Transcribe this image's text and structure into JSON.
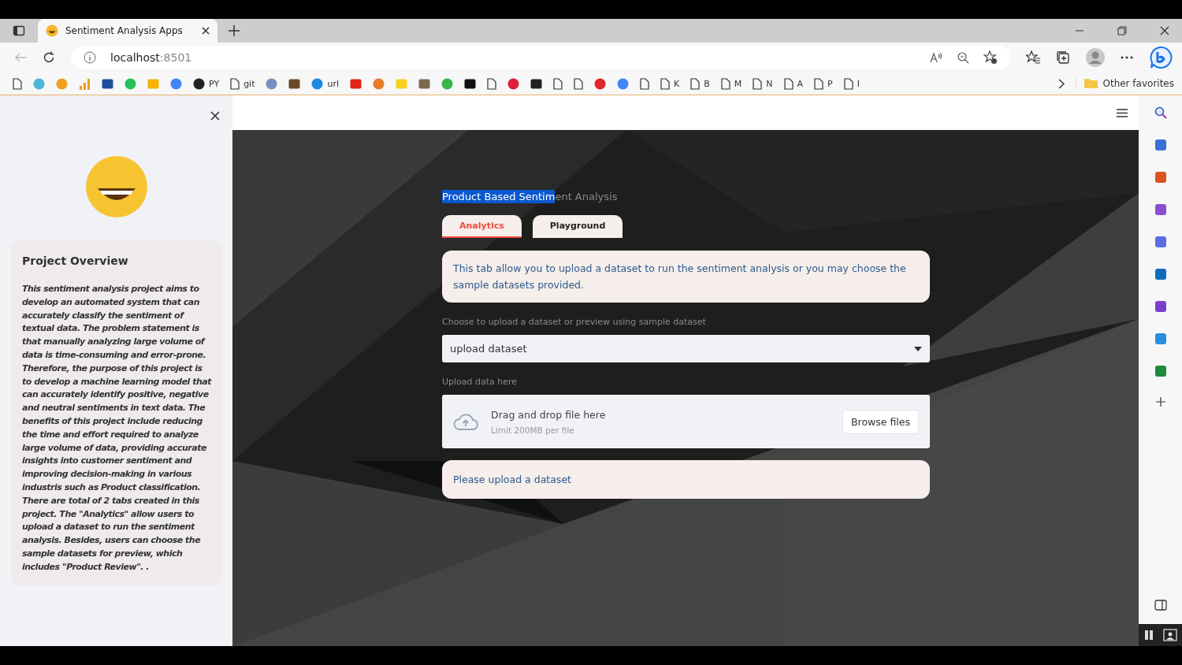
{
  "browser": {
    "tab_title": "Sentiment Analysis Apps",
    "address_host": "localhost",
    "address_port": ":8501",
    "bookmarks": [
      {
        "kind": "page"
      },
      {
        "kind": "dot",
        "color": "#4fb6d6"
      },
      {
        "kind": "dot",
        "color": "#f0a020"
      },
      {
        "kind": "bars",
        "color": "#f29b1d"
      },
      {
        "kind": "square",
        "color": "#1f4e9a"
      },
      {
        "kind": "dot",
        "color": "#25c15a"
      },
      {
        "kind": "square",
        "color": "#f4b400"
      },
      {
        "kind": "dot",
        "color": "#4285f4"
      },
      {
        "kind": "dot",
        "color": "#222222",
        "label": "PY"
      },
      {
        "kind": "page",
        "label": "git"
      },
      {
        "kind": "dot",
        "color": "#7a8fc0"
      },
      {
        "kind": "square",
        "color": "#6b4a2a"
      },
      {
        "kind": "dot",
        "color": "#1e88e5",
        "label": "url"
      },
      {
        "kind": "square",
        "color": "#e62117"
      },
      {
        "kind": "dot",
        "color": "#e87a2a"
      },
      {
        "kind": "square",
        "color": "#f7d11e"
      },
      {
        "kind": "square",
        "color": "#7a6a50"
      },
      {
        "kind": "dot",
        "color": "#3cb54a"
      },
      {
        "kind": "square",
        "color": "#111111"
      },
      {
        "kind": "page"
      },
      {
        "kind": "dot",
        "color": "#e0203a"
      },
      {
        "kind": "square",
        "color": "#202020"
      },
      {
        "kind": "page"
      },
      {
        "kind": "page"
      },
      {
        "kind": "dot",
        "color": "#e3262e"
      },
      {
        "kind": "dot",
        "color": "#4285f4"
      },
      {
        "kind": "page"
      },
      {
        "kind": "page",
        "label": "K"
      },
      {
        "kind": "page",
        "label": "B"
      },
      {
        "kind": "page",
        "label": "M"
      },
      {
        "kind": "page",
        "label": "N"
      },
      {
        "kind": "page",
        "label": "A"
      },
      {
        "kind": "page",
        "label": "P"
      },
      {
        "kind": "page",
        "label": "I"
      }
    ],
    "other_favorites": "Other favorites",
    "side_tools": [
      {
        "color": "#3a6fd8"
      },
      {
        "color": "#d9541e"
      },
      {
        "color": "#8a4fd0"
      },
      {
        "color": "#5b6de0"
      },
      {
        "color": "#0f6cbd"
      },
      {
        "color": "#7b3fd0"
      },
      {
        "color": "#2a8de0"
      },
      {
        "color": "#1f8a3a"
      }
    ]
  },
  "sidebar": {
    "card_title": "Project Overview",
    "card_text": "This sentiment analysis project aims to develop an automated system that can accurately classify the sentiment of textual data. The problem statement is that manually analyzing large volume of data is time-consuming and error-prone. Therefore, the purpose of this project is to develop a machine learning model that can accurately identify positive, negative and neutral sentiments in text data. The benefits of this project include reducing the time and effort required to analyze large volume of data, providing accurate insights into customer sentiment and improving decision-making in various industris such as Product classification. There are total of 2 tabs created in this project. The \"Analytics\" allow users to upload a dataset to run the sentiment analysis. Besides, users can choose the sample datasets for preview, which includes \"Product Review\". ."
  },
  "main": {
    "title_selected": "Product Based Sentim",
    "title_rest": "ent Analysis",
    "tabs": [
      {
        "label": "Analytics",
        "selected": true
      },
      {
        "label": "Playground",
        "selected": false
      }
    ],
    "info": "This tab allow you to upload a dataset to run the sentiment analysis or you may choose the sample datasets provided.",
    "select_label": "Choose to upload a dataset or preview using sample dataset",
    "select_value": "upload dataset",
    "upload_label": "Upload data here",
    "dropzone_title": "Drag and drop file here",
    "dropzone_limit": "Limit 200MB per file",
    "browse_button": "Browse files",
    "notice": "Please upload a dataset"
  }
}
